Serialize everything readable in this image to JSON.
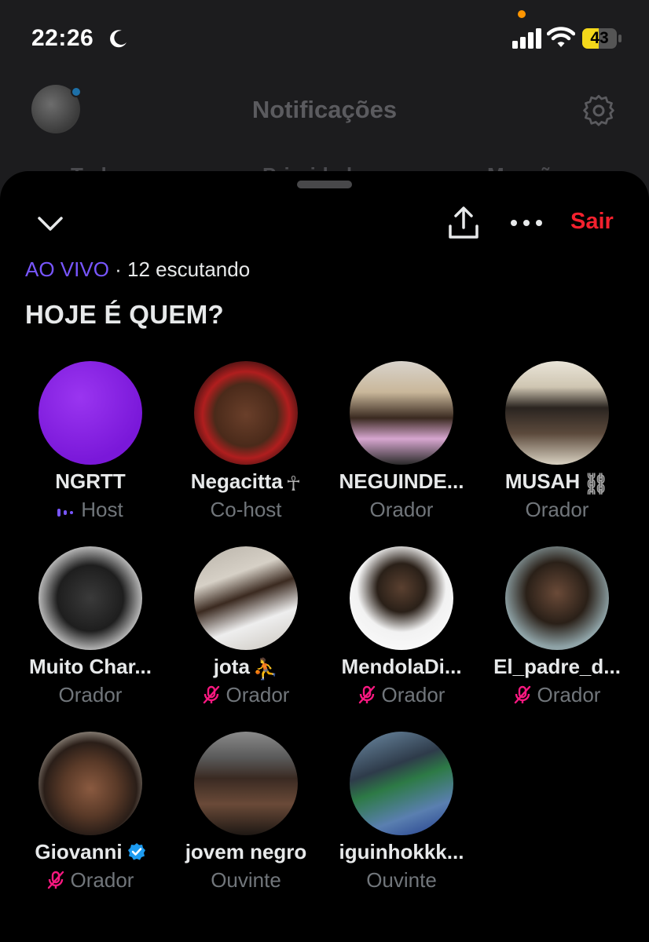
{
  "status_bar": {
    "time": "22:26",
    "battery": "43"
  },
  "background": {
    "title": "Notificações",
    "tabs": [
      "Todas",
      "Prioridade",
      "Menções"
    ]
  },
  "header": {
    "leave_label": "Sair"
  },
  "space": {
    "live_label": "AO VIVO",
    "listeners": "· 12 escutando",
    "title": "HOJE É QUEM?"
  },
  "participants": [
    {
      "name": "NGRTT",
      "role": "Host",
      "icon": "speaking-indicator-icon",
      "avatar": "purple-avatar"
    },
    {
      "name": "Negacitta",
      "role": "Co-host",
      "icon": "",
      "avatar": "photo"
    },
    {
      "name": "NEGUINDE...",
      "role": "Orador",
      "icon": "",
      "avatar": "photo"
    },
    {
      "name": "MUSAH",
      "role": "Orador",
      "icon": "",
      "avatar": "photo"
    },
    {
      "name": "Muito Char...",
      "role": "Orador",
      "icon": "",
      "avatar": "photo"
    },
    {
      "name": "jota",
      "role": "Orador",
      "icon": "mic-off-icon",
      "avatar": "photo"
    },
    {
      "name": "MendolaDi...",
      "role": "Orador",
      "icon": "mic-off-icon",
      "avatar": "photo"
    },
    {
      "name": "El_padre_d...",
      "role": "Orador",
      "icon": "mic-off-icon",
      "avatar": "photo"
    },
    {
      "name": "Giovanni",
      "role": "Orador",
      "icon": "mic-off-icon",
      "avatar": "photo"
    },
    {
      "name": "jovem negro",
      "role": "Ouvinte",
      "icon": "",
      "avatar": "photo"
    },
    {
      "name": "iguinhokkk...",
      "role": "Ouvinte",
      "icon": "",
      "avatar": "photo"
    }
  ],
  "colors": {
    "live": "#7856ff",
    "leave": "#f4212e",
    "mic_off": "#f91880",
    "verified": "#1d9bf0"
  }
}
